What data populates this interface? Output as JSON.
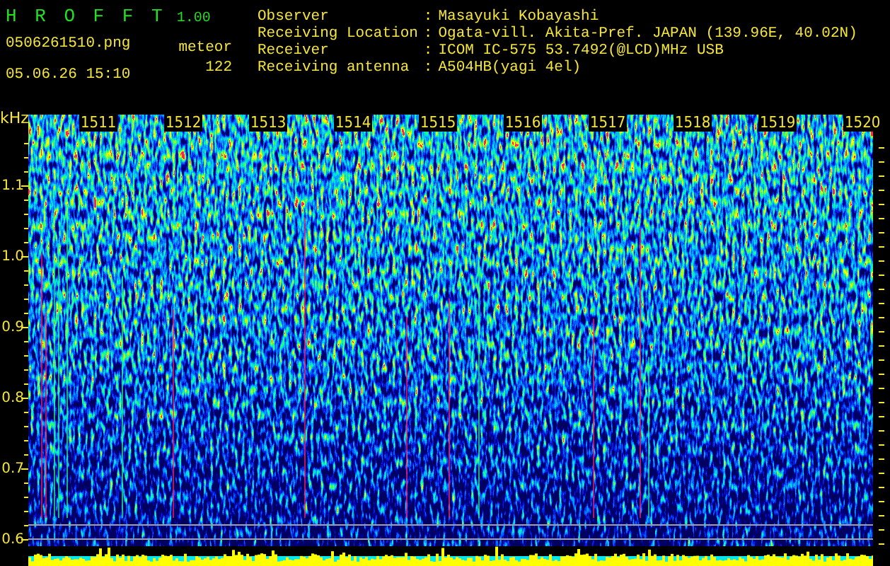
{
  "app": {
    "name": "H R O F F T",
    "version": "1.00"
  },
  "file": {
    "name": "0506261510.png",
    "datetime": "05.06.26 15:10"
  },
  "meteor": {
    "label": "meteor",
    "count": "122"
  },
  "station": [
    {
      "label": "Observer",
      "separator": ":",
      "value": "Masayuki Kobayashi"
    },
    {
      "label": "Receiving Location",
      "separator": ":",
      "value": "Ogata-vill. Akita-Pref. JAPAN (139.96E, 40.02N)"
    },
    {
      "label": "Receiver",
      "separator": ":",
      "value": "ICOM IC-575 53.7492(@LCD)MHz USB"
    },
    {
      "label": "Receiving antenna",
      "separator": ":",
      "value": "A504HB(yagi 4el)"
    }
  ],
  "spectrogram": {
    "y_unit": "kHz",
    "y_labels": [
      "1.1",
      "1.0",
      "0.9",
      "0.8",
      "0.7",
      "0.6"
    ],
    "time_labels": [
      "1511",
      "1512",
      "1513",
      "1514",
      "1515",
      "1516",
      "1517",
      "1518",
      "1519",
      "1520"
    ]
  }
}
